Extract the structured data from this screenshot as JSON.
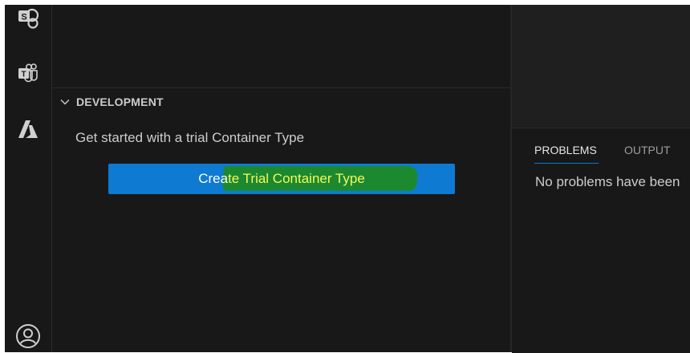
{
  "activity_bar": {
    "icons": [
      "sharepoint-icon",
      "teams-toolkit-icon",
      "azure-icon",
      "account-icon"
    ],
    "sharepoint_letter": "S",
    "teams_letter": "T"
  },
  "sidebar": {
    "section": {
      "title": "DEVELOPMENT",
      "expanded": true
    },
    "welcome_text": "Get started with a trial Container Type",
    "create_button": {
      "label_prefix": "Crea",
      "label_highlighted": "te Trial Container Type"
    }
  },
  "panel": {
    "tabs": [
      {
        "label": "PROBLEMS",
        "active": true
      },
      {
        "label": "OUTPUT",
        "active": false
      }
    ],
    "message": "No problems have been"
  },
  "colors": {
    "background": "#181818",
    "editor": "#1f1f1f",
    "button": "#0e7ad2",
    "highlight": "#1e8c14",
    "highlight_text": "#f4f75a",
    "tab_accent": "#0078d4"
  }
}
